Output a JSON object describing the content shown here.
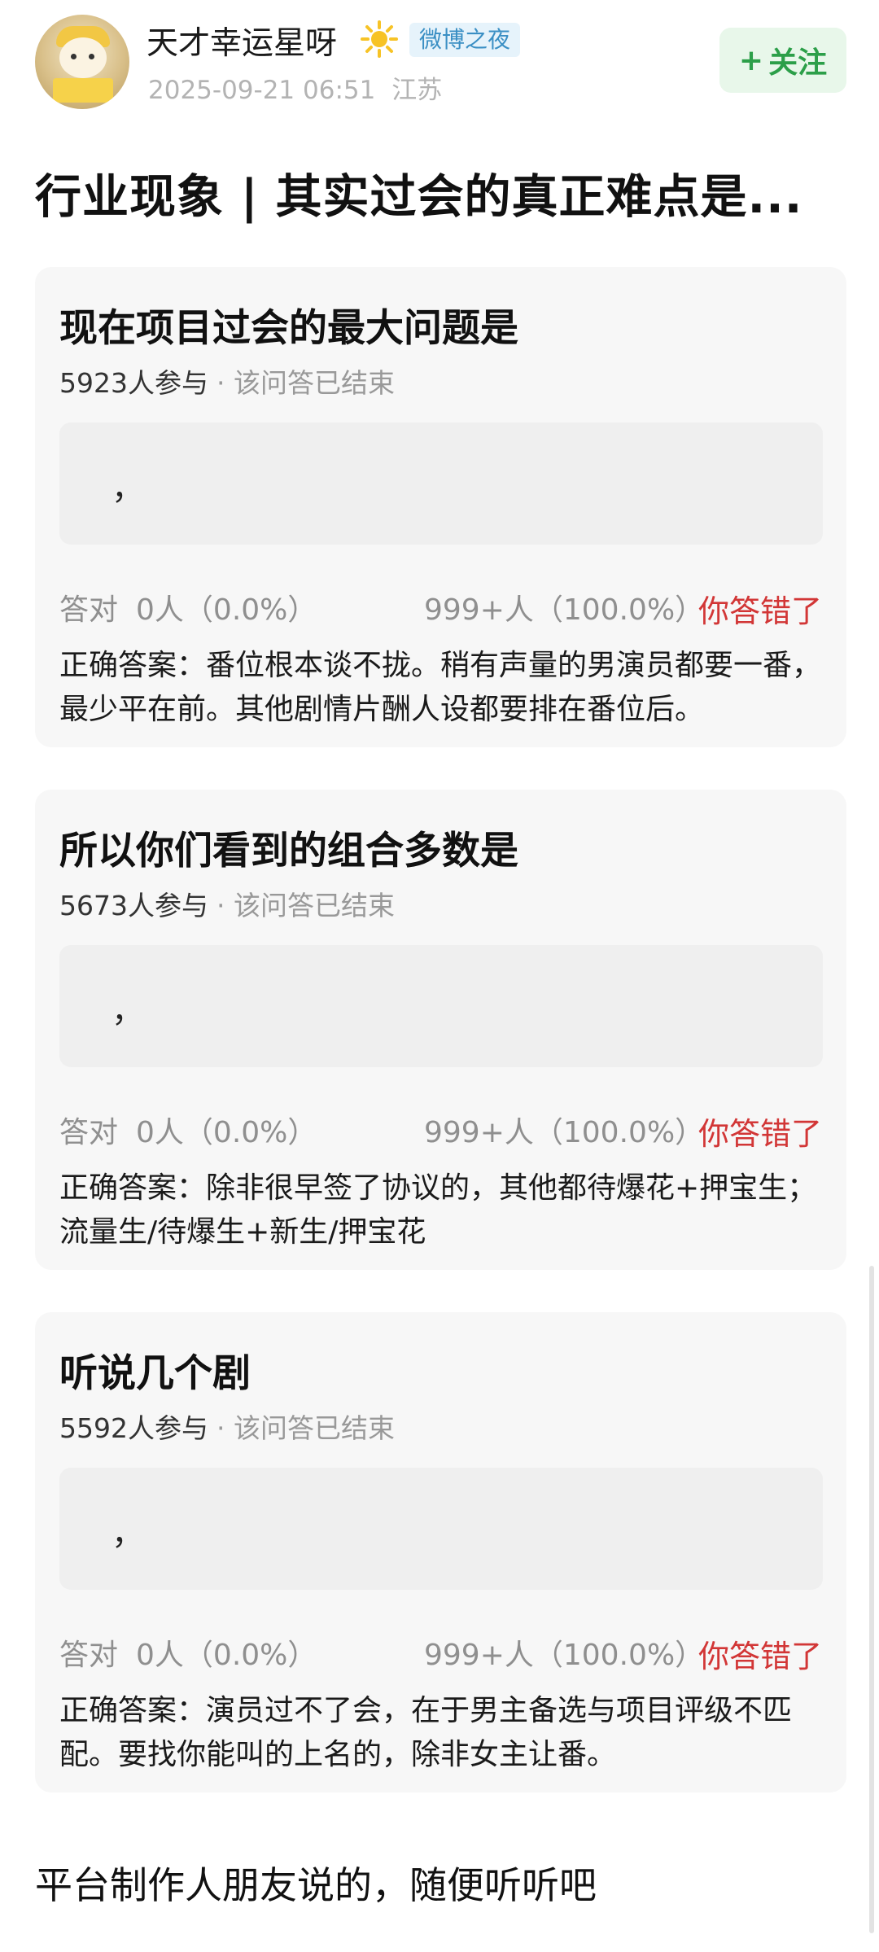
{
  "header": {
    "username": "天才幸运星呀",
    "badge": "微博之夜",
    "timestamp": "2025-09-21 06:51",
    "location": "江苏",
    "follow_plus": "+",
    "follow_label": "关注"
  },
  "post": {
    "title": "行业现象 | 其实过会的真正难点是..."
  },
  "quizzes": [
    {
      "question": "现在项目过会的最大问题是",
      "participants": "5923人参与",
      "status": "· 该问答已结束",
      "option_text": "，",
      "correct_label": "答对",
      "correct_stat": "0人（0.0%）",
      "wrong_stat": "999+人（100.0%）",
      "result": "你答错了",
      "answer": "正确答案：番位根本谈不拢。稍有声量的男演员都要一番，最少平在前。其他剧情片酬人设都要排在番位后。"
    },
    {
      "question": "所以你们看到的组合多数是",
      "participants": "5673人参与",
      "status": "· 该问答已结束",
      "option_text": "，",
      "correct_label": "答对",
      "correct_stat": "0人（0.0%）",
      "wrong_stat": "999+人（100.0%）",
      "result": "你答错了",
      "answer": "正确答案：除非很早签了协议的，其他都待爆花+押宝生；流量生/待爆生+新生/押宝花"
    },
    {
      "question": "听说几个剧",
      "participants": "5592人参与",
      "status": "· 该问答已结束",
      "option_text": "，",
      "correct_label": "答对",
      "correct_stat": "0人（0.0%）",
      "wrong_stat": "999+人（100.0%）",
      "result": "你答错了",
      "answer": "正确答案：演员过不了会，在于男主备选与项目评级不匹配。要找你能叫的上名的，除非女主让番。"
    }
  ],
  "footer": {
    "text": "平台制作人朋友说的，随便听听吧"
  },
  "colors": {
    "accent_green": "#2c9f49",
    "wrong_red": "#d23636",
    "badge_blue": "#3a8fc4"
  }
}
